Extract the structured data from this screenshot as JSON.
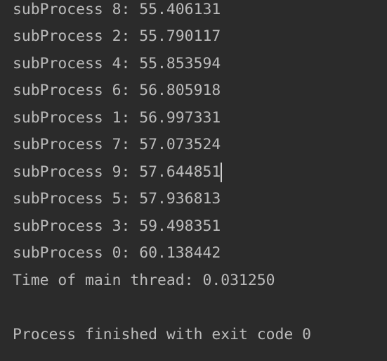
{
  "console": {
    "lines": [
      "subProcess 8: 55.406131",
      "subProcess 2: 55.790117",
      "subProcess 4: 55.853594",
      "subProcess 6: 56.805918",
      "subProcess 1: 56.997331",
      "subProcess 7: 57.073524",
      "subProcess 9: 57.644851",
      "subProcess 5: 57.936813",
      "subProcess 3: 59.498351",
      "subProcess 0: 60.138442",
      "Time of main thread: 0.031250",
      "",
      "Process finished with exit code 0"
    ]
  },
  "colors": {
    "background": "#2b2b2b",
    "text": "#bbbbbb",
    "caret": "#cfcfcf"
  }
}
